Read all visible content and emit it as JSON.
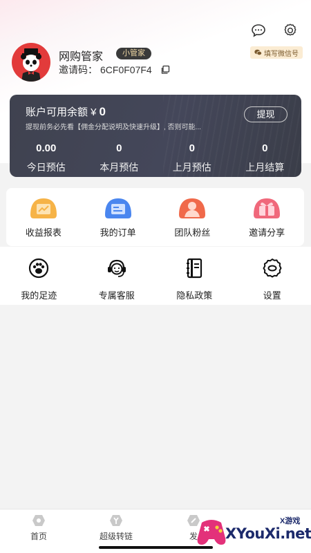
{
  "header": {
    "message_icon": "chat-bubble-icon",
    "settings_icon": "gear-icon"
  },
  "profile": {
    "name": "网购管家",
    "badge": "小管家",
    "invite_label": "邀请码：",
    "invite_code": "6CF0F07F4",
    "wechat_button": "填写微信号"
  },
  "balance": {
    "title": "账户可用余额 ¥",
    "amount": "0",
    "note": "提现前务必先看【佣金分配说明及快速升级】, 否则可能...",
    "withdraw_label": "提现",
    "stats": [
      {
        "value": "0.00",
        "label": "今日预估"
      },
      {
        "value": "0",
        "label": "本月预估"
      },
      {
        "value": "0",
        "label": "上月预估"
      },
      {
        "value": "0",
        "label": "上月结算"
      }
    ]
  },
  "menu_primary": [
    {
      "label": "收益报表",
      "icon": "chart-report-icon",
      "color": "#f6b347"
    },
    {
      "label": "我的订单",
      "icon": "order-list-icon",
      "color": "#4a86ef"
    },
    {
      "label": "团队粉丝",
      "icon": "user-team-icon",
      "color": "#f0694a"
    },
    {
      "label": "邀请分享",
      "icon": "gift-share-icon",
      "color": "#f0687b"
    }
  ],
  "menu_secondary": [
    {
      "label": "我的足迹",
      "icon": "paw-footprint-icon"
    },
    {
      "label": "专属客服",
      "icon": "customer-service-icon"
    },
    {
      "label": "隐私政策",
      "icon": "notebook-icon"
    },
    {
      "label": "设置",
      "icon": "gear-icon"
    }
  ],
  "tabbar": [
    {
      "label": "首页",
      "icon": "home-icon"
    },
    {
      "label": "超级转链",
      "icon": "link-convert-icon"
    },
    {
      "label": "发",
      "icon": "publish-icon"
    }
  ],
  "watermark": {
    "text": "XYouXi.net",
    "small": "X游戏"
  },
  "colors": {
    "card_bg": "#42454f",
    "badge_bg": "#3a3a3a",
    "badge_text": "#f1d9a5",
    "wechat_bg": "#fbecd3",
    "avatar_bg": "#e23b3b"
  }
}
